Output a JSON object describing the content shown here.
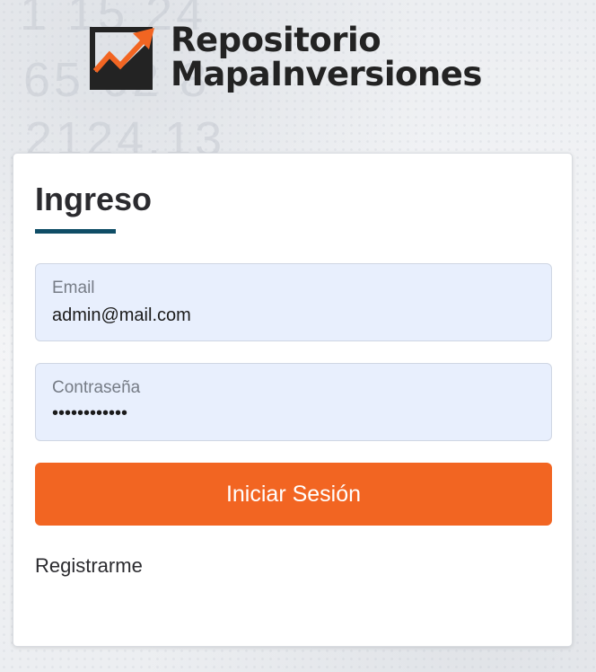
{
  "background": {
    "numbers": [
      "1 15 24",
      "65 62 8",
      "2124.13"
    ]
  },
  "brand": {
    "logo_icon": "chart-growth-arrow-icon",
    "line1": "Repositorio",
    "line2": "MapaInversiones",
    "accent_color": "#f26522",
    "dark_color": "#232323"
  },
  "login": {
    "title": "Ingreso",
    "underline_color": "#0f4d66",
    "email": {
      "label": "Email",
      "value": "admin@mail.com"
    },
    "password": {
      "label": "Contraseña",
      "value_masked": "••••••••••••"
    },
    "submit_label": "Iniciar Sesión",
    "submit_color": "#f26522",
    "register_label": "Registrarme"
  }
}
